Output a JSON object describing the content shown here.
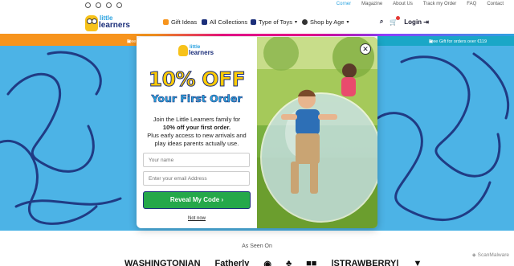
{
  "top_links": [
    "Corner",
    "Magazine",
    "About Us",
    "Track my Order",
    "FAQ",
    "Contact"
  ],
  "social_icons": [
    "instagram-icon",
    "facebook-icon",
    "tiktok-icon",
    "pinterest-icon"
  ],
  "brand": {
    "line1": "little",
    "line2": "learners"
  },
  "nav": {
    "gift_ideas": "Gift Ideas",
    "all_collections": "All Collections",
    "type_of_toys": "Type of Toys",
    "shop_by_age": "Shop by Age",
    "login": "Login"
  },
  "promo": {
    "left": "Free Returns Within 14 Days",
    "right": "Free Gift for orders over €119"
  },
  "popup": {
    "brand_line1": "little",
    "brand_line2": "learners",
    "headline": "10% OFF",
    "subhead": "Your First Order",
    "body_line1": "Join the Little Learners family for",
    "body_bold": "10% off your first order.",
    "body_line2": "Plus early access to new arrivals and play ideas parents actually use.",
    "name_placeholder": "Your name",
    "email_placeholder": "Enter your email Address",
    "cta": "Reveal My Code ›",
    "dismiss": "Not now"
  },
  "seen_on": "As Seen On",
  "press_logos": [
    "WASHINGTONIAN",
    "Fatherly",
    "◉",
    "♣",
    "■■",
    "|STRAWBERRY|",
    "▼"
  ],
  "scan_badge": "ScanMalware",
  "colors": {
    "brand_blue": "#1c2f7a",
    "accent_blue": "#2ca3e0",
    "promo_orange": "#f7941d",
    "promo_teal": "#1aa7c7",
    "cta_green": "#25a84a",
    "headline_yellow": "#ffcb05",
    "hero_blue": "#4cb3e6"
  }
}
